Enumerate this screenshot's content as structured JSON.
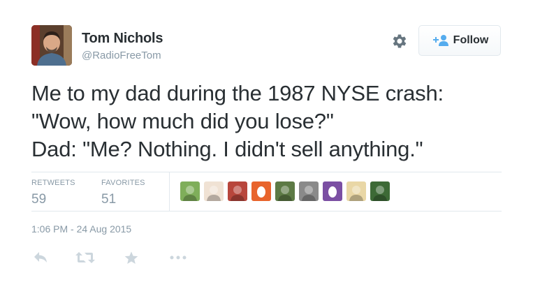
{
  "user": {
    "full_name": "Tom Nichols",
    "screen_name": "@RadioFreeTom"
  },
  "header": {
    "follow_label": "Follow"
  },
  "tweet": {
    "lines": [
      "Me to my dad during the 1987 NYSE crash:",
      "\"Wow, how much did you lose?\"",
      "Dad: \"Me? Nothing. I didn't sell anything.\""
    ]
  },
  "stats": {
    "retweets_label": "RETWEETS",
    "retweets_count": "59",
    "favorites_label": "FAVORITES",
    "favorites_count": "51"
  },
  "favoriters": [
    {
      "name": "favoriter-avatar-bird",
      "color": "#7fae5a"
    },
    {
      "name": "favoriter-avatar-cartoon",
      "color": "#f0e2d4"
    },
    {
      "name": "favoriter-avatar-flag",
      "color": "#b8463c"
    },
    {
      "name": "favoriter-avatar-egg-orange",
      "color": "#e8642c"
    },
    {
      "name": "favoriter-avatar-landscape",
      "color": "#5d7a45"
    },
    {
      "name": "favoriter-avatar-grey",
      "color": "#8a8a8a"
    },
    {
      "name": "favoriter-avatar-egg-purple",
      "color": "#7b4fa3"
    },
    {
      "name": "favoriter-avatar-sketch",
      "color": "#e9d7a6"
    },
    {
      "name": "favoriter-avatar-plant",
      "color": "#3d6a36"
    }
  ],
  "timestamp": "1:06 PM - 24 Aug 2015",
  "colors": {
    "text": "#292f33",
    "muted": "#8899a6",
    "follow_icon": "#55acee",
    "action_icons": "#ccd6dd"
  },
  "icons": {
    "settings": "gear-icon",
    "follow": "add-user-icon",
    "reply": "reply-icon",
    "retweet": "retweet-icon",
    "favorite": "star-icon",
    "more": "more-icon"
  }
}
